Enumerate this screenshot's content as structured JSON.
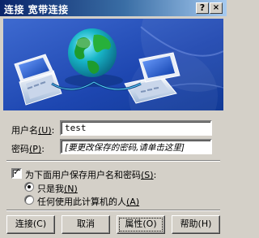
{
  "window": {
    "title": "连接 宽带连接",
    "help_glyph": "?",
    "close_glyph": "×"
  },
  "banner": {
    "icon": "network-globe-laptops-illustration"
  },
  "form": {
    "username_label": "用户名",
    "username_key": "(U)",
    "username_value": "test",
    "password_label": "密码",
    "password_key": "(P)",
    "password_placeholder": "[要更改保存的密码,请单击这里]",
    "save_checkbox_label": "为下面用户保存用户名和密码",
    "save_checkbox_key": "(S)",
    "save_checked": true,
    "option_me_label": "只是我",
    "option_me_key": "(N)",
    "option_anyone_label": "任何使用此计算机的人",
    "option_anyone_key": "(A)",
    "selected_option": "只是我"
  },
  "buttons": {
    "connect": "连接(C)",
    "cancel": "取消",
    "properties": "属性(O)",
    "help": "帮助(H)"
  },
  "colors": {
    "title_bar": "#0a246a",
    "dialog_bg": "#d4d0c8",
    "banner_bg": "#1c3f97"
  }
}
